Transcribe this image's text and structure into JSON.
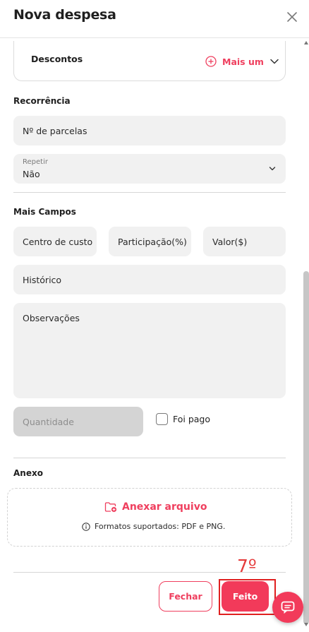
{
  "header": {
    "title": "Nova despesa",
    "close_icon": "close-icon"
  },
  "descontos": {
    "label": "Descontos",
    "add_label": "Mais um"
  },
  "recorrencia": {
    "title": "Recorrência",
    "parcelas_placeholder": "Nº de parcelas",
    "repetir_label": "Repetir",
    "repetir_value": "Não"
  },
  "mais_campos": {
    "title": "Mais Campos",
    "centro_custo": "Centro de custo",
    "participacao": "Participação(%)",
    "valor": "Valor($)",
    "historico": "Histórico",
    "observacoes": "Observações",
    "quantidade": "Quantidade",
    "foi_pago": "Foi pago"
  },
  "anexo": {
    "title": "Anexo",
    "upload_label": "Anexar arquivo",
    "formats": "Formatos suportados: PDF e PNG."
  },
  "footer": {
    "step_label": "7º",
    "fechar_label": "Fechar",
    "feito_label": "Feito"
  },
  "colors": {
    "accent": "#ef3f5e",
    "highlight": "#e02020"
  }
}
